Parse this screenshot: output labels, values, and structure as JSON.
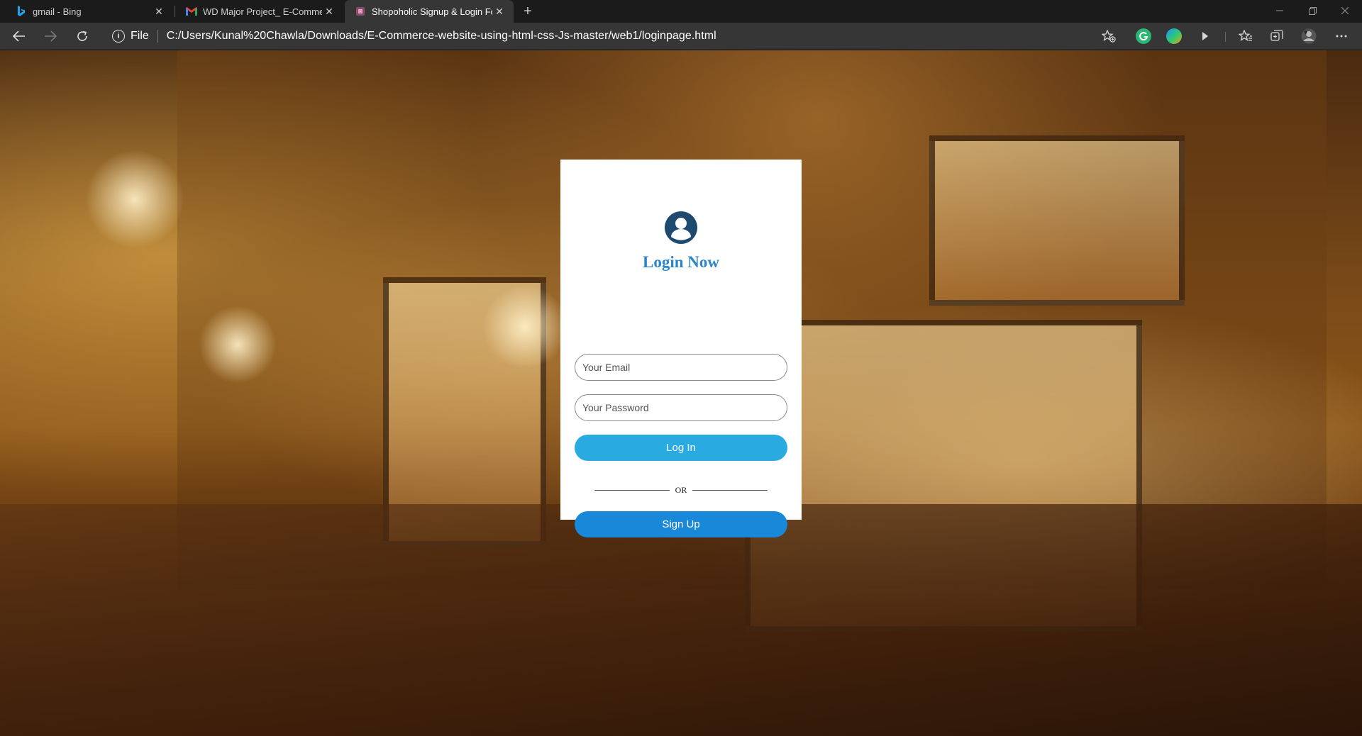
{
  "browser": {
    "tabs": [
      {
        "title": "gmail - Bing",
        "icon": "bing-icon",
        "active": false
      },
      {
        "title": "WD Major Project_ E-Commerce",
        "icon": "gmail-icon",
        "active": false
      },
      {
        "title": "Shopoholic Signup & Login Form",
        "icon": "page-icon",
        "active": true
      }
    ],
    "address": {
      "scheme_label": "File",
      "url": "C:/Users/Kunal%20Chawla/Downloads/E-Commerce-website-using-html-css-Js-master/web1/loginpage.html"
    },
    "colors": {
      "tabstrip": "#1b1b1b",
      "toolbar": "#363636"
    }
  },
  "login": {
    "heading": "Login Now",
    "email_placeholder": "Your Email",
    "password_placeholder": "Your Password",
    "login_button": "Log In",
    "or_text": "OR",
    "signup_button": "Sign Up",
    "colors": {
      "heading": "#2a86c6",
      "login_button": "#29abe2",
      "signup_button": "#1a88d8"
    }
  }
}
